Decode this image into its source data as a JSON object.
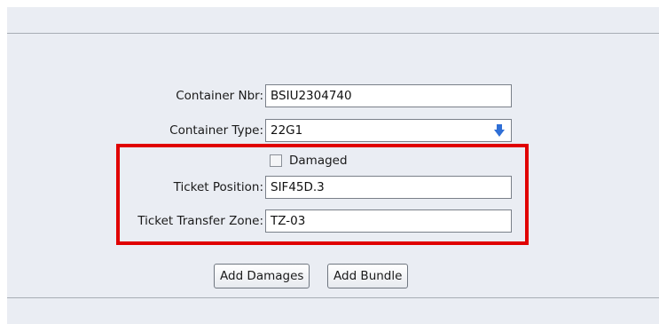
{
  "form": {
    "container_nbr": {
      "label": "Container Nbr:",
      "value": "BSIU2304740"
    },
    "container_type": {
      "label": "Container Type:",
      "value": "22G1",
      "icon": "arrow-down-icon"
    },
    "damaged": {
      "label": "Damaged",
      "checked": false
    },
    "ticket_position": {
      "label": "Ticket Position:",
      "value": "SIF45D.3"
    },
    "ticket_transfer_zone": {
      "label": "Ticket Transfer Zone:",
      "value": "TZ-03"
    }
  },
  "buttons": {
    "add_damages": "Add Damages",
    "add_bundle": "Add Bundle"
  },
  "colors": {
    "panel_bg": "#eaedf3",
    "highlight": "#e00000",
    "dropdown_arrow": "#2f6fd6"
  }
}
